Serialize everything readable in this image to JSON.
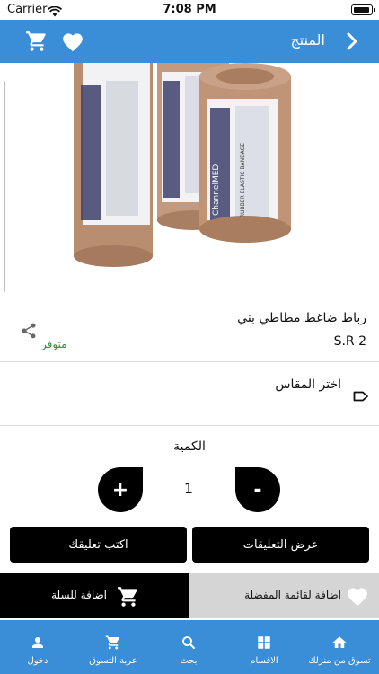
{
  "status_bar": {
    "carrier": "Carrier",
    "time": "7:08 PM"
  },
  "header": {
    "title": "المنتج"
  },
  "product": {
    "name": "رباط ضاغط مطاطي بني",
    "price": "S.R 2",
    "stock_status": "متوفر",
    "image_labels": {
      "brand": "ChannelMED",
      "type": "RUBBER ELASTIC BANDAGE"
    }
  },
  "size": {
    "label": "اختر المقاس"
  },
  "quantity": {
    "label": "الكمية",
    "value": "1",
    "plus": "+",
    "minus": "-"
  },
  "actions": {
    "write_comment": "اكتب تعليقك",
    "view_reviews": "عرض التعليقات"
  },
  "bottom_actions": {
    "add_to_cart": "اضافة للسلة",
    "add_to_favorites": "اضافة لقائمة المفضلة"
  },
  "tabs": [
    {
      "label": "دخول",
      "icon": "person-icon"
    },
    {
      "label": "عربة التسوق",
      "icon": "cart-icon"
    },
    {
      "label": "بحث",
      "icon": "search-icon"
    },
    {
      "label": "الاقسام",
      "icon": "grid-icon"
    },
    {
      "label": "تسوق من منزلك",
      "icon": "home-icon"
    }
  ],
  "colors": {
    "primary": "#3a8ed8",
    "stock": "#2e8b3e",
    "dark": "#000000",
    "favorite_bg": "#d5d5d5"
  }
}
